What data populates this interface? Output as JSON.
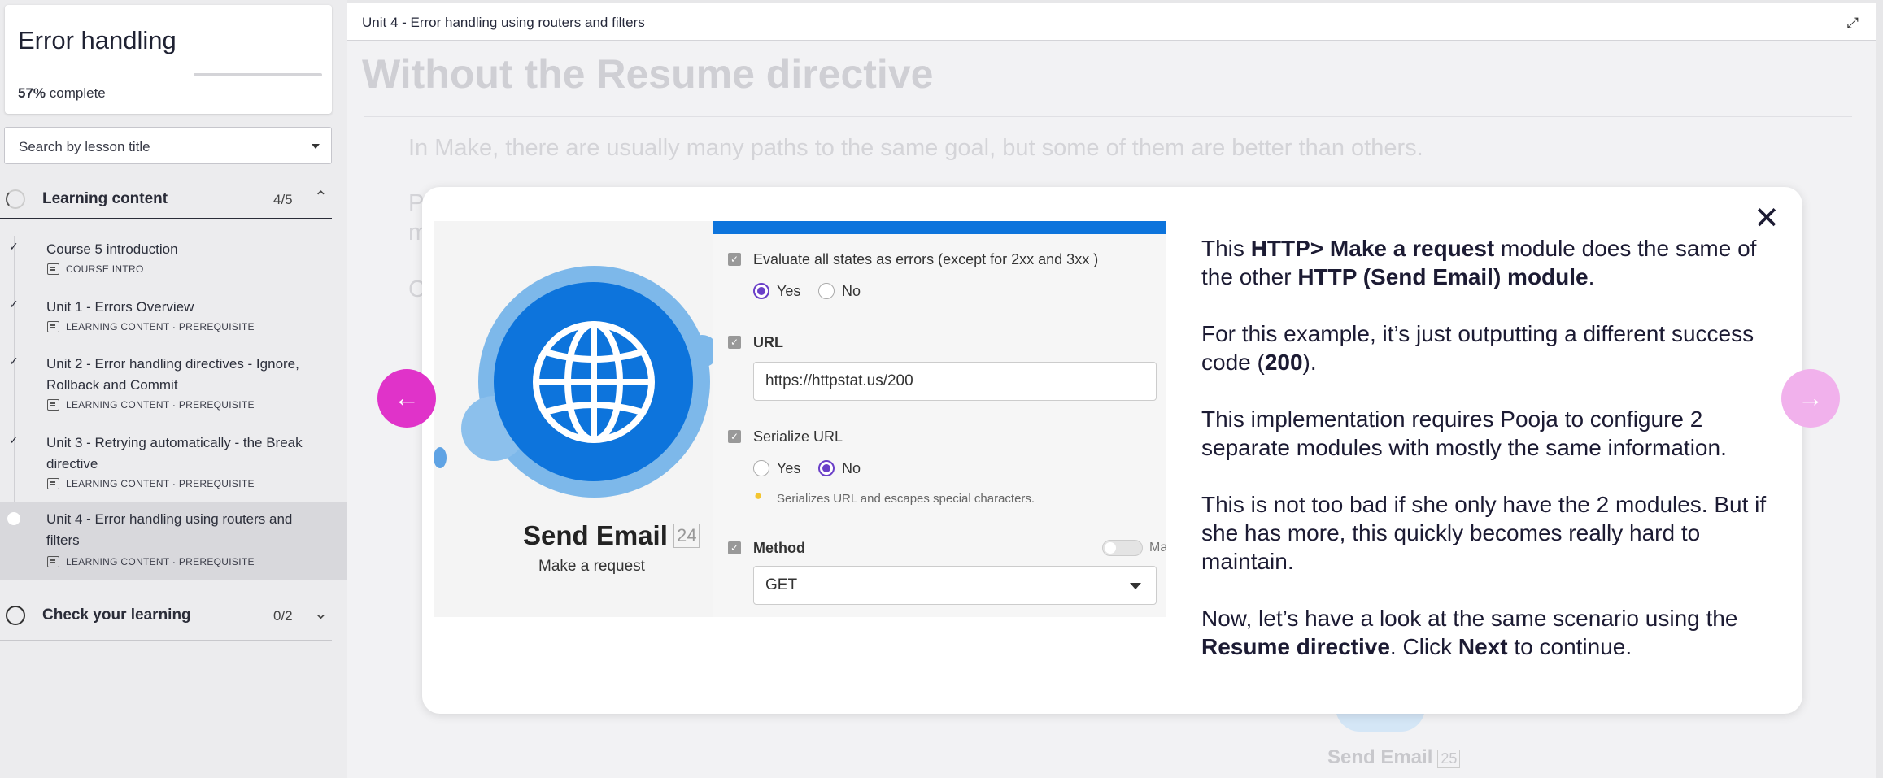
{
  "sidebar": {
    "course_title": "Error handling",
    "progress_percent": "57%",
    "progress_suffix": "complete",
    "progress_value": 0.57,
    "search_placeholder": "Search by lesson title",
    "sections": [
      {
        "label": "Learning content",
        "count": "4/5",
        "chevron": "^"
      },
      {
        "label": "Check your learning",
        "count": "0/2",
        "chevron": "v"
      }
    ],
    "lessons": [
      {
        "title": "Course 5 introduction",
        "meta": "COURSE INTRO"
      },
      {
        "title": "Unit 1 - Errors Overview",
        "meta": "LEARNING CONTENT · PREREQUISITE"
      },
      {
        "title": "Unit 2 - Error handling directives - Ignore, Rollback and Commit",
        "meta": "LEARNING CONTENT · PREREQUISITE"
      },
      {
        "title": "Unit 3 - Retrying automatically - the Break directive",
        "meta": "LEARNING CONTENT · PREREQUISITE"
      },
      {
        "title": "Unit 4 - Error handling using routers and filters",
        "meta": "LEARNING CONTENT · PREREQUISITE"
      }
    ]
  },
  "main": {
    "header_title": "Unit 4 - Error handling using routers and filters",
    "bg_heading": "Without the Resume directive",
    "bg_paragraph": "In Make, there are usually many paths to the same goal, but some of them are better than others.",
    "bg_frag1": "P",
    "bg_frag2": "m",
    "bg_frag3": "C",
    "bg_send": "Send Email",
    "bg_send_badge": "25"
  },
  "modal": {
    "image": {
      "module_title": "Send Email",
      "module_badge": "24",
      "module_subtitle": "Make a request",
      "field1_label": "Evaluate all states as errors (except for 2xx and 3xx )",
      "yes": "Yes",
      "no": "No",
      "field2_label": "URL",
      "url_value": "https://httpstat.us/200",
      "field3_label": "Serialize URL",
      "hint": "Serializes URL and escapes special characters.",
      "field4_label": "Method",
      "map_label": "Map",
      "method_value": "GET"
    },
    "text": {
      "p1_a": "This ",
      "p1_b": "HTTP> Make a request",
      "p1_c": " module does the same of the other ",
      "p1_d": "HTTP (Send Email) module",
      "p1_e": ".",
      "p2_a": "For this example, it’s just outputting a different success code (",
      "p2_b": "200",
      "p2_c": ").",
      "p3": "This implementation requires Pooja to configure 2 separate modules with mostly the same information.",
      "p4": "This is not too bad if she only have the 2 modules. But if she has more, this quickly becomes really hard to maintain.",
      "p5_a": "Now, let’s have a look at the same scenario using the ",
      "p5_b": "Resume directive",
      "p5_c": ". Click ",
      "p5_d": "Next",
      "p5_e": " to continue."
    }
  },
  "colors": {
    "accent": "#e033c9",
    "accent_disabled": "#f1b1ec",
    "module_blue": "#0d74dc",
    "radio_purple": "#6a3fc8"
  },
  "icons": [
    "check-icon",
    "document-icon",
    "chevron-up-icon",
    "chevron-down-icon",
    "expand-icon",
    "close-icon",
    "arrow-left-icon",
    "arrow-right-icon",
    "globe-icon",
    "lightbulb-icon"
  ]
}
